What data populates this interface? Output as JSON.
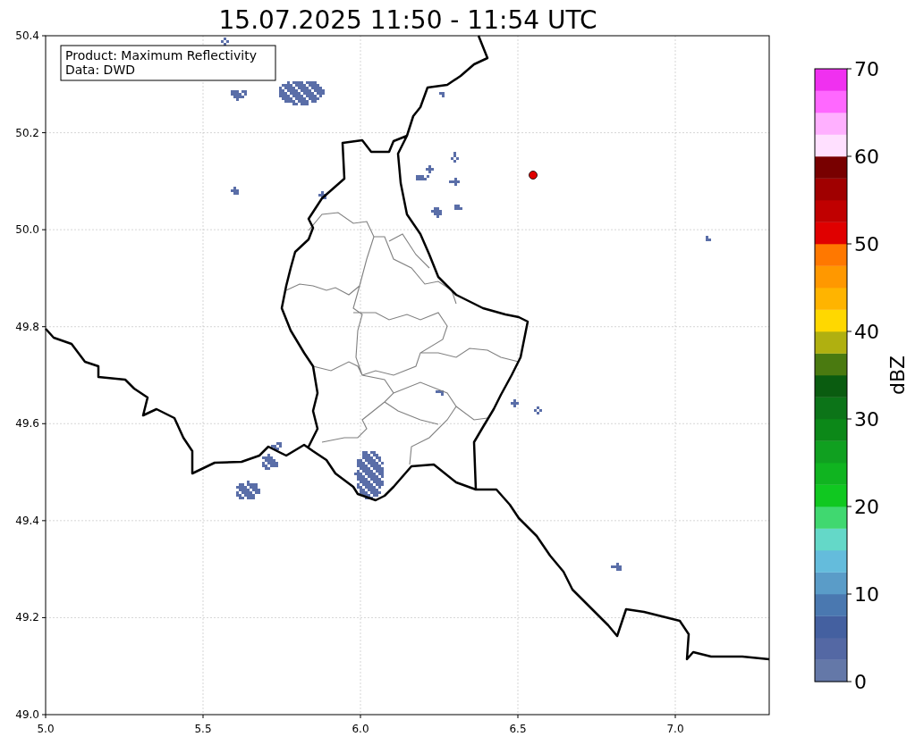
{
  "title": "15.07.2025 11:50 - 11:54 UTC",
  "info_box": {
    "lines": [
      "Product: Maximum Reflectivity",
      "Data: DWD"
    ]
  },
  "map": {
    "xticks": [
      "5.0",
      "5.5",
      "6.0",
      "6.5",
      "7.0"
    ],
    "yticks": [
      "50.4",
      "50.2",
      "50.0",
      "49.8",
      "49.6",
      "49.4",
      "49.2",
      "49.0"
    ]
  },
  "colorbar": {
    "label": "dBZ",
    "ticks": [
      "70",
      "60",
      "50",
      "40",
      "30",
      "20",
      "10",
      "0"
    ],
    "segments": [
      {
        "color": "#6478a8"
      },
      {
        "color": "#5468a4"
      },
      {
        "color": "#4460a0"
      },
      {
        "color": "#4a78b0"
      },
      {
        "color": "#5a9cc8"
      },
      {
        "color": "#64bcdc"
      },
      {
        "color": "#64d8c8"
      },
      {
        "color": "#40d870"
      },
      {
        "color": "#10c820"
      },
      {
        "color": "#10b420"
      },
      {
        "color": "#10a020"
      },
      {
        "color": "#0c8818"
      },
      {
        "color": "#0c7418"
      },
      {
        "color": "#0a5c10"
      },
      {
        "color": "#4a7a10"
      },
      {
        "color": "#b0b010"
      },
      {
        "color": "#ffd800"
      },
      {
        "color": "#ffb400"
      },
      {
        "color": "#ff9800"
      },
      {
        "color": "#ff7800"
      },
      {
        "color": "#e00000"
      },
      {
        "color": "#c00000"
      },
      {
        "color": "#a00000"
      },
      {
        "color": "#780000"
      },
      {
        "color": "#ffe0ff"
      },
      {
        "color": "#ffb0ff"
      },
      {
        "color": "#ff68ff"
      },
      {
        "color": "#f030f0"
      }
    ]
  }
}
